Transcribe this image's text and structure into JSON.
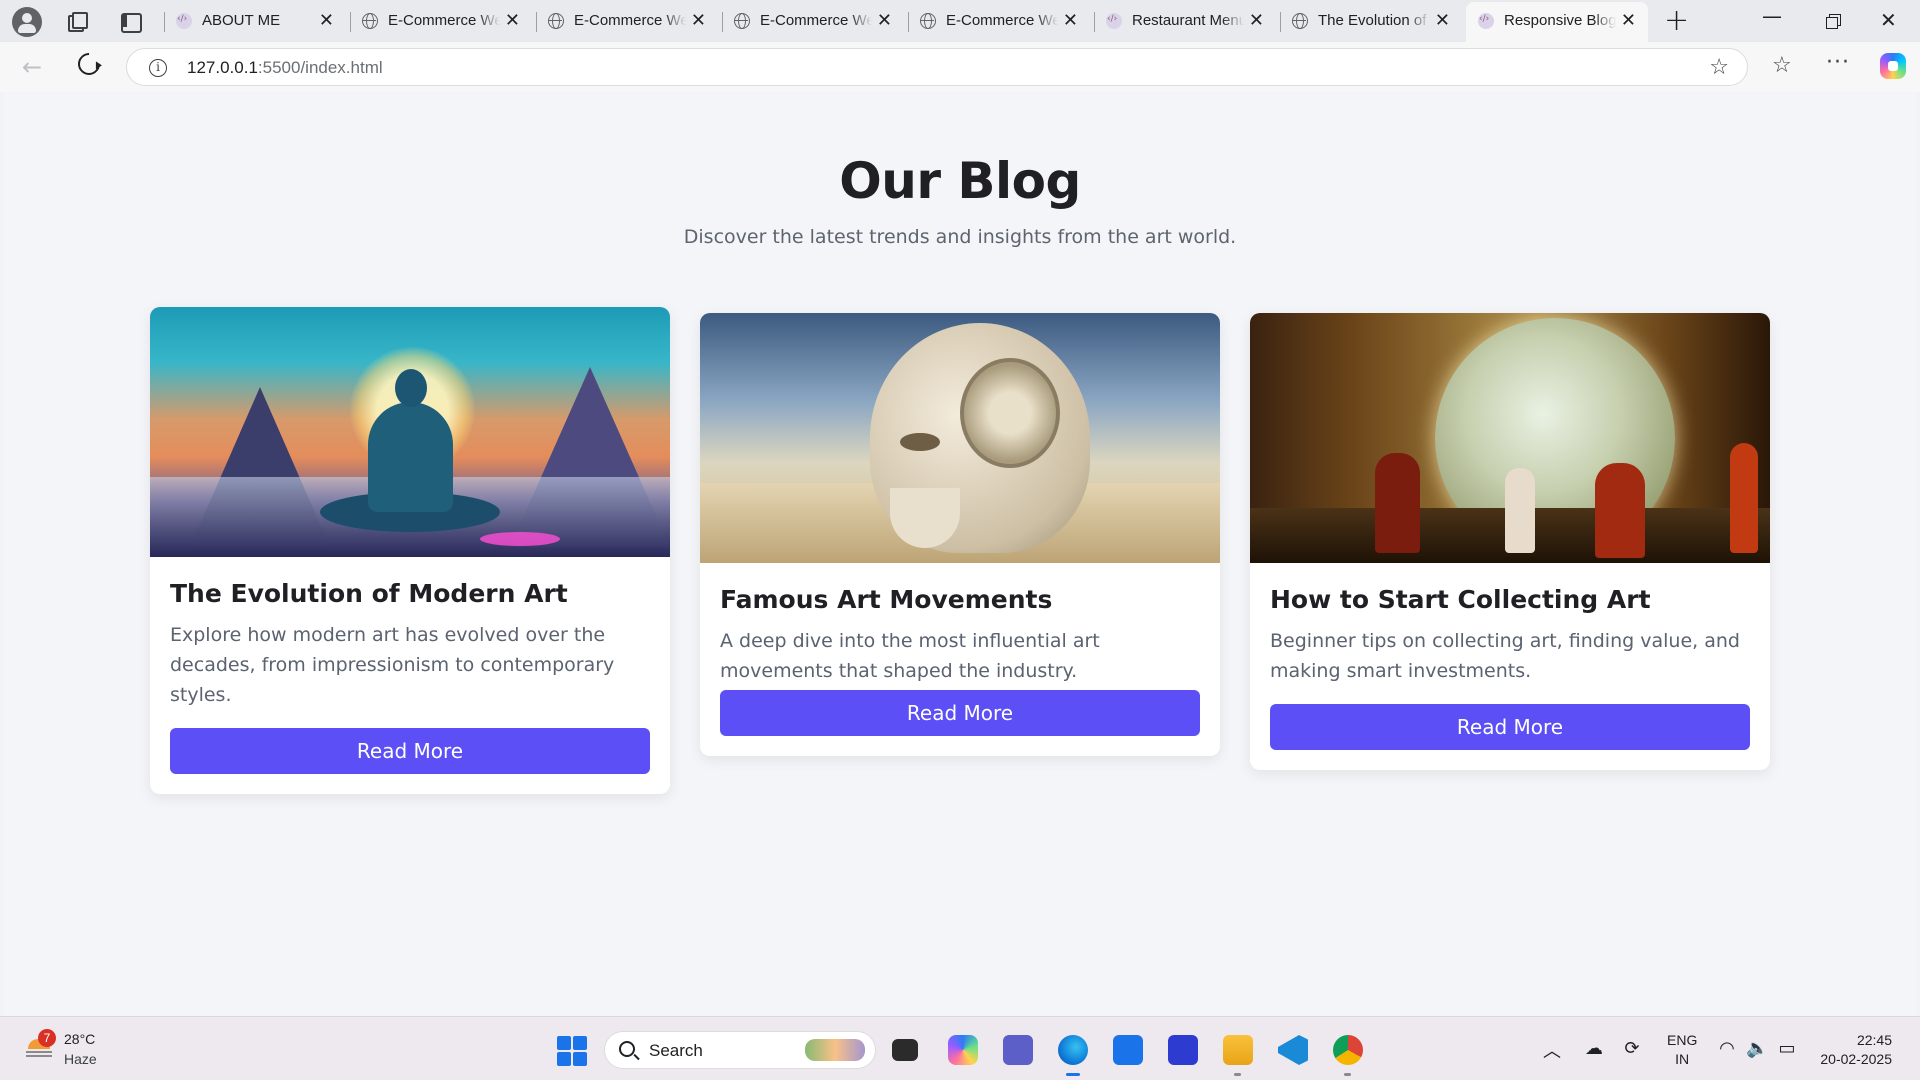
{
  "browser": {
    "tabs": [
      {
        "title": "ABOUT ME",
        "favicon": "web-icon"
      },
      {
        "title": "E-Commerce We",
        "favicon": "globe-icon"
      },
      {
        "title": "E-Commerce We",
        "favicon": "globe-icon"
      },
      {
        "title": "E-Commerce We",
        "favicon": "globe-icon"
      },
      {
        "title": "E-Commerce We",
        "favicon": "globe-icon"
      },
      {
        "title": "Restaurant Menu",
        "favicon": "web-icon"
      },
      {
        "title": "The Evolution of",
        "favicon": "globe-icon"
      },
      {
        "title": "Responsive Blog",
        "favicon": "web-icon",
        "active": true
      }
    ],
    "address": {
      "host": "127.0.0.1",
      "path": ":5500/index.html"
    }
  },
  "page": {
    "title": "Our Blog",
    "subtitle": "Discover the latest trends and insights from the art world.",
    "posts": [
      {
        "title": "The Evolution of Modern Art",
        "excerpt": "Explore how modern art has evolved over the decades, from impressionism to contemporary styles.",
        "button": "Read More"
      },
      {
        "title": "Famous Art Movements",
        "excerpt": "A deep dive into the most influential art movements that shaped the industry.",
        "button": "Read More"
      },
      {
        "title": "How to Start Collecting Art",
        "excerpt": "Beginner tips on collecting art, finding value, and making smart investments.",
        "button": "Read More"
      }
    ],
    "accent_color": "#5b4ff5"
  },
  "taskbar": {
    "weather": {
      "temp": "28°C",
      "desc": "Haze",
      "badge": "7"
    },
    "search_label": "Search",
    "lang": {
      "line1": "ENG",
      "line2": "IN"
    },
    "clock": {
      "time": "22:45",
      "date": "20-02-2025"
    }
  }
}
